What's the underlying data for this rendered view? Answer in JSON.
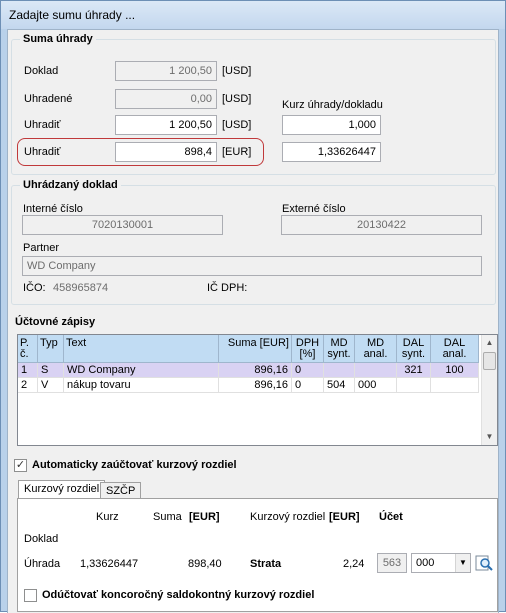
{
  "window": {
    "title": "Zadajte sumu úhrady ..."
  },
  "suma": {
    "group_title": "Suma úhrady",
    "doklad_label": "Doklad",
    "doklad_value": "1 200,50",
    "doklad_cur": "[USD]",
    "uhradene_label": "Uhradené",
    "uhradene_value": "0,00",
    "uhradene_cur": "[USD]",
    "kurz_label": "Kurz úhrady/dokladu",
    "uhradit_label": "Uhradiť",
    "uhradit_value": "1 200,50",
    "uhradit_cur": "[USD]",
    "kurz_value": "1,000",
    "uhradit_eur_label": "Uhradiť",
    "uhradit_eur_value": "898,4",
    "uhradit_eur_cur": "[EUR]",
    "kurz_eur_value": "1,33626447"
  },
  "doklad": {
    "group_title": "Uhrádzaný doklad",
    "interne_label": "Interné číslo",
    "interne_value": "7020130001",
    "externe_label": "Externé číslo",
    "externe_value": "20130422",
    "partner_label": "Partner",
    "partner_value": "WD Company",
    "ico_label": "IČO:",
    "ico_value": "458965874",
    "icdph_label": "IČ DPH:"
  },
  "zapisy": {
    "title": "Účtovné zápisy",
    "headers": [
      "P. č.",
      "Typ",
      "Text",
      "Suma [EUR]",
      "DPH [%]",
      "MD synt.",
      "MD anal.",
      "DAL synt.",
      "DAL anal."
    ],
    "rows": [
      [
        "1",
        "S",
        "WD Company",
        "896,16",
        "0",
        "",
        "",
        "321",
        "100"
      ],
      [
        "2",
        "V",
        "nákup tovaru",
        "896,16",
        "0",
        "504",
        "000",
        "",
        ""
      ]
    ]
  },
  "auto": {
    "label": "Automaticky zaúčtovať kurzový rozdiel",
    "checked": true
  },
  "tabs": [
    "Kurzový rozdiel",
    "SZČP"
  ],
  "kurzovy": {
    "h_kurz": "Kurz",
    "h_suma": "Suma",
    "h_suma_cur": "[EUR]",
    "h_kr": "Kurzový rozdiel",
    "h_kr_cur": "[EUR]",
    "h_ucet": "Účet",
    "doklad_label": "Doklad",
    "uhrada_label": "Úhrada",
    "uhrada_kurz": "1,33626447",
    "uhrada_suma": "898,40",
    "uhrada_strata": "Strata",
    "uhrada_kr": "2,24",
    "ucet_synt": "563",
    "ucet_anal": "000"
  },
  "odu": {
    "label": "Odúčtovať koncoročný saldokontný kurzový rozdiel",
    "checked": false
  }
}
